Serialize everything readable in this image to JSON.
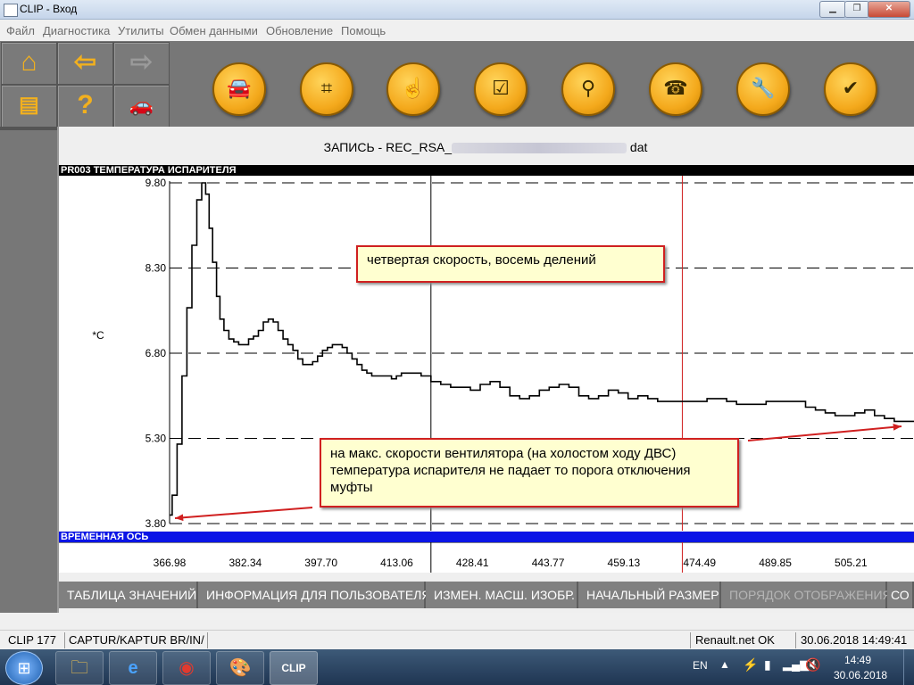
{
  "window": {
    "title": "CLIP - Вход"
  },
  "menu": [
    "Файл",
    "Диагностика",
    "Утилиты",
    "Обмен данными",
    "Обновление",
    "Помощь"
  ],
  "record": {
    "title_prefix": "ЗАПИСЬ - REC_RSA_",
    "title_suffix": "dat"
  },
  "chart_header": "PR003  ТЕМПЕРАТУРА ИСПАРИТЕЛЯ",
  "time_axis_header": "ВРЕМЕННАЯ ОСЬ",
  "chart_data": {
    "type": "line",
    "title": "PR003  ТЕМПЕРАТУРА ИСПАРИТЕЛЯ",
    "ylabel": "*C",
    "xlabel": "ВРЕМЕННАЯ ОСЬ",
    "ylim": [
      3.8,
      9.8
    ],
    "xlim": [
      366.98,
      518.0
    ],
    "y_ticks": [
      "9.80",
      "8.30",
      "6.80",
      "5.30",
      "3.80"
    ],
    "x_ticks": [
      "366.98",
      "382.34",
      "397.70",
      "413.06",
      "428.41",
      "443.77",
      "459.13",
      "474.49",
      "489.85",
      "505.21"
    ],
    "cursors": [
      {
        "x": 420.0,
        "color": "#000000"
      },
      {
        "x": 471.0,
        "color": "#d02020"
      }
    ],
    "series": [
      {
        "color": "#000000",
        "x": [
          366.98,
          367.5,
          368.5,
          369.5,
          370.5,
          371.5,
          372.5,
          373.5,
          374.3,
          375.0,
          375.7,
          376.5,
          377.2,
          378.0,
          379.0,
          380.0,
          381.0,
          382.0,
          383.0,
          384.0,
          385.0,
          386.0,
          387.0,
          388.0,
          389.0,
          390.0,
          391.0,
          392.0,
          393.0,
          394.0,
          395.0,
          396.0,
          397.0,
          398.0,
          399.0,
          400.0,
          401.0,
          402.0,
          403.0,
          404.0,
          405.0,
          406.0,
          407.0,
          408.0,
          409.0,
          410.0,
          411.0,
          412.0,
          413.0,
          414.0,
          416.0,
          418.0,
          420.0,
          422.0,
          424.0,
          426.0,
          428.0,
          430.0,
          432.0,
          434.0,
          436.0,
          438.0,
          440.0,
          442.0,
          444.0,
          446.0,
          448.0,
          450.0,
          452.0,
          454.0,
          456.0,
          458.0,
          460.0,
          462.0,
          464.0,
          466.0,
          468.0,
          470.0,
          472.0,
          474.0,
          476.0,
          478.0,
          480.0,
          482.0,
          484.0,
          486.0,
          488.0,
          490.0,
          492.0,
          494.0,
          496.0,
          498.0,
          500.0,
          502.0,
          504.0,
          506.0,
          508.0,
          510.0,
          512.0,
          514.0,
          516.0,
          518.0
        ],
        "y": [
          3.95,
          4.3,
          5.2,
          6.4,
          7.6,
          8.7,
          9.5,
          9.8,
          9.6,
          9.0,
          8.4,
          7.8,
          7.4,
          7.2,
          7.05,
          7.0,
          6.95,
          6.95,
          7.05,
          7.1,
          7.2,
          7.35,
          7.4,
          7.35,
          7.2,
          7.05,
          6.95,
          6.85,
          6.7,
          6.6,
          6.6,
          6.65,
          6.75,
          6.85,
          6.9,
          6.95,
          6.95,
          6.9,
          6.8,
          6.7,
          6.6,
          6.5,
          6.45,
          6.4,
          6.4,
          6.4,
          6.4,
          6.35,
          6.4,
          6.45,
          6.45,
          6.4,
          6.3,
          6.25,
          6.2,
          6.2,
          6.15,
          6.25,
          6.3,
          6.2,
          6.05,
          6.0,
          6.05,
          6.15,
          6.2,
          6.25,
          6.2,
          6.05,
          6.0,
          6.05,
          6.15,
          6.1,
          6.0,
          6.05,
          6.0,
          5.95,
          5.95,
          5.95,
          5.95,
          5.95,
          6.0,
          6.0,
          5.95,
          5.9,
          5.9,
          5.9,
          5.95,
          5.95,
          5.95,
          5.95,
          5.85,
          5.8,
          5.75,
          5.7,
          5.7,
          5.75,
          5.8,
          5.7,
          5.65,
          5.6,
          5.6,
          5.6
        ]
      }
    ]
  },
  "annotations": [
    {
      "text": "четвертая скорость, восемь делений"
    },
    {
      "text": "на макс. скорости вентилятора (на холостом ходу ДВС) температура испарителя не падает то порога отключения муфты"
    }
  ],
  "bottom_buttons": [
    {
      "label": "ТАБЛИЦА ЗНАЧЕНИЙ",
      "enabled": true
    },
    {
      "label": "ИНФОРМАЦИЯ ДЛЯ ПОЛЬЗОВАТЕЛЯ",
      "enabled": true
    },
    {
      "label": "ИЗМЕН. МАСШ. ИЗОБР.",
      "enabled": true
    },
    {
      "label": "НАЧАЛЬНЫЙ РАЗМЕР",
      "enabled": true
    },
    {
      "label": "ПОРЯДОК ОТОБРАЖЕНИЯ",
      "enabled": false
    },
    {
      "label": "СО",
      "enabled": true
    }
  ],
  "status": {
    "version": "CLIP 177",
    "vehicle": "CAPTUR/KAPTUR BR/IN/",
    "network": "Renault.net OK",
    "datetime": "30.06.2018 14:49:41"
  },
  "taskbar": {
    "lang": "EN",
    "time": "14:49",
    "date": "30.06.2018"
  },
  "colors": {
    "toolbar_bg": "#777777",
    "tool_button": "#f4a91c",
    "time_axis": "#0a14e6",
    "cursor_red": "#d02020"
  },
  "icons": {
    "nav": [
      "home-icon",
      "back-arrow-icon",
      "forward-arrow-icon",
      "print-icon",
      "help-icon",
      "vehicle-info-icon"
    ],
    "tools": [
      "vehicle-identification-icon",
      "gearbox-icon",
      "touch-test-icon",
      "checklist-icon",
      "diagnostic-search-icon",
      "phone-support-icon",
      "wrench-icon",
      "vehicle-check-icon"
    ]
  }
}
